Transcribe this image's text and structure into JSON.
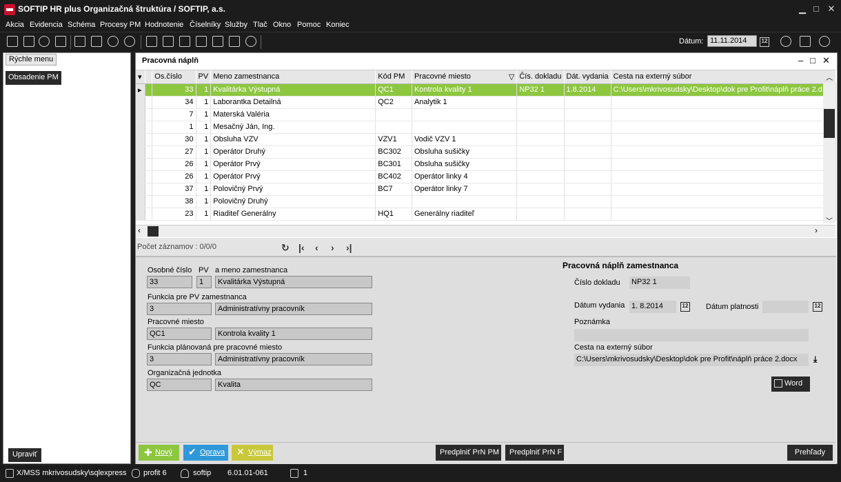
{
  "app": {
    "title": "SOFTIP HR plus Organizačná štruktúra / SOFTIP, a.s."
  },
  "menu": [
    "Akcia",
    "Evidencia",
    "Schéma",
    "Procesy PM",
    "Hodnotenie",
    "Číselníky",
    "Služby",
    "Tlač",
    "Okno",
    "Pomoc",
    "Koniec"
  ],
  "toolbar": {
    "date_label": "Dátum:",
    "date_value": "11.11.2014",
    "calendar_glyph": "12"
  },
  "left": {
    "quick_menu": "Rýchle menu",
    "item": "Obsadenie PM",
    "edit_button": "Upraviť"
  },
  "main": {
    "title": "Pracovná náplň"
  },
  "grid": {
    "columns": [
      "Os.číslo",
      "PV",
      "Meno zamestnanca",
      "Kód PM",
      "Pracovné miesto",
      "Čís. dokladu",
      "Dát. vydania",
      "Cesta na externý súbor"
    ],
    "rows": [
      {
        "os": "33",
        "pv": "1",
        "meno": "Kvalitárka Výstupná",
        "kod": "QC1",
        "miesto": "Kontrola kvality 1",
        "doklad": "NP32 1",
        "datum": "1.8.2014",
        "cesta": "C:\\Users\\mkrivosudsky\\Desktop\\dok pre Profit\\náplň práce 2.d"
      },
      {
        "os": "34",
        "pv": "1",
        "meno": "Laborantka Detailná",
        "kod": "QC2",
        "miesto": "Analytik 1",
        "doklad": "",
        "datum": "",
        "cesta": ""
      },
      {
        "os": "7",
        "pv": "1",
        "meno": "Materská Valéria",
        "kod": "",
        "miesto": "",
        "doklad": "",
        "datum": "",
        "cesta": ""
      },
      {
        "os": "1",
        "pv": "1",
        "meno": "Mesačný Ján, Ing.",
        "kod": "",
        "miesto": "",
        "doklad": "",
        "datum": "",
        "cesta": ""
      },
      {
        "os": "30",
        "pv": "1",
        "meno": "Obsluha  VZV",
        "kod": "VZV1",
        "miesto": "Vodič VZV 1",
        "doklad": "",
        "datum": "",
        "cesta": ""
      },
      {
        "os": "27",
        "pv": "1",
        "meno": "Operátor Druhý",
        "kod": "BC302",
        "miesto": "Obsluha sušičky",
        "doklad": "",
        "datum": "",
        "cesta": ""
      },
      {
        "os": "26",
        "pv": "1",
        "meno": "Operátor Prvý",
        "kod": "BC301",
        "miesto": "Obsluha sušičky",
        "doklad": "",
        "datum": "",
        "cesta": ""
      },
      {
        "os": "26",
        "pv": "1",
        "meno": "Operátor Prvý",
        "kod": "BC402",
        "miesto": "Operátor linky 4",
        "doklad": "",
        "datum": "",
        "cesta": ""
      },
      {
        "os": "37",
        "pv": "1",
        "meno": "Polovičný  Prvý",
        "kod": "BC7",
        "miesto": "Operátor linky 7",
        "doklad": "",
        "datum": "",
        "cesta": ""
      },
      {
        "os": "38",
        "pv": "1",
        "meno": "Polovičný Druhý",
        "kod": "",
        "miesto": "",
        "doklad": "",
        "datum": "",
        "cesta": ""
      },
      {
        "os": "23",
        "pv": "1",
        "meno": "Riaditeľ Generálny",
        "kod": "HQ1",
        "miesto": "Generálny riaditeľ",
        "doklad": "",
        "datum": "",
        "cesta": ""
      }
    ],
    "record_count": "Počet záznamov : 0/0/0"
  },
  "detail": {
    "label_os": "Osobné číslo",
    "label_pv": "PV",
    "label_meno": "a meno zamestnanca",
    "os": "33",
    "pv": "1",
    "meno": "Kvalitárka Výstupná",
    "label_funkcia": "Funkcia pre PV zamestnanca",
    "funkcia_kod": "3",
    "funkcia_nazov": "Administratívny pracovník",
    "label_miesto": "Pracovné miesto",
    "miesto_kod": "QC1",
    "miesto_nazov": "Kontrola kvality 1",
    "label_funkcia_plan": "Funkcia plánovaná pre pracovné miesto",
    "funkcia_plan_kod": "3",
    "funkcia_plan_nazov": "Administratívny pracovník",
    "label_org": "Organizačná jednotka",
    "org_kod": "QC",
    "org_nazov": "Kvalita",
    "napln_title": "Pracovná náplň zamestnanca",
    "label_cislo": "Číslo dokladu",
    "cislo": "NP32 1",
    "label_vydania": "Dátum vydania",
    "vydania": "1. 8.2014",
    "label_platnosti": "Dátum platnosti",
    "platnosti": "",
    "label_poznamka": "Poznámka",
    "poznamka": "",
    "label_cesta": "Cesta na externý súbor",
    "cesta": "C:\\Users\\mkrivosudsky\\Desktop\\dok pre Profit\\náplň práce 2.docx",
    "word_button": "Word"
  },
  "buttons": {
    "novy": "Nový",
    "oprava": "Oprava",
    "vymaz": "Výmaz",
    "predplnit_pm": "Predplniť PrN PM",
    "predplnit_f": "Predplniť PrN F",
    "prehlady": "Prehľady"
  },
  "status": {
    "server": "X/MSS mkrivosudsky\\sqlexpress",
    "db": "profit 6",
    "user": "softip",
    "version": "6.01.01-061",
    "windows": "1"
  },
  "colors": {
    "accent": "#8dc63f",
    "dark": "#1c1c1c",
    "button_blue": "#2f98d8",
    "button_yellow": "#c8c83a"
  }
}
